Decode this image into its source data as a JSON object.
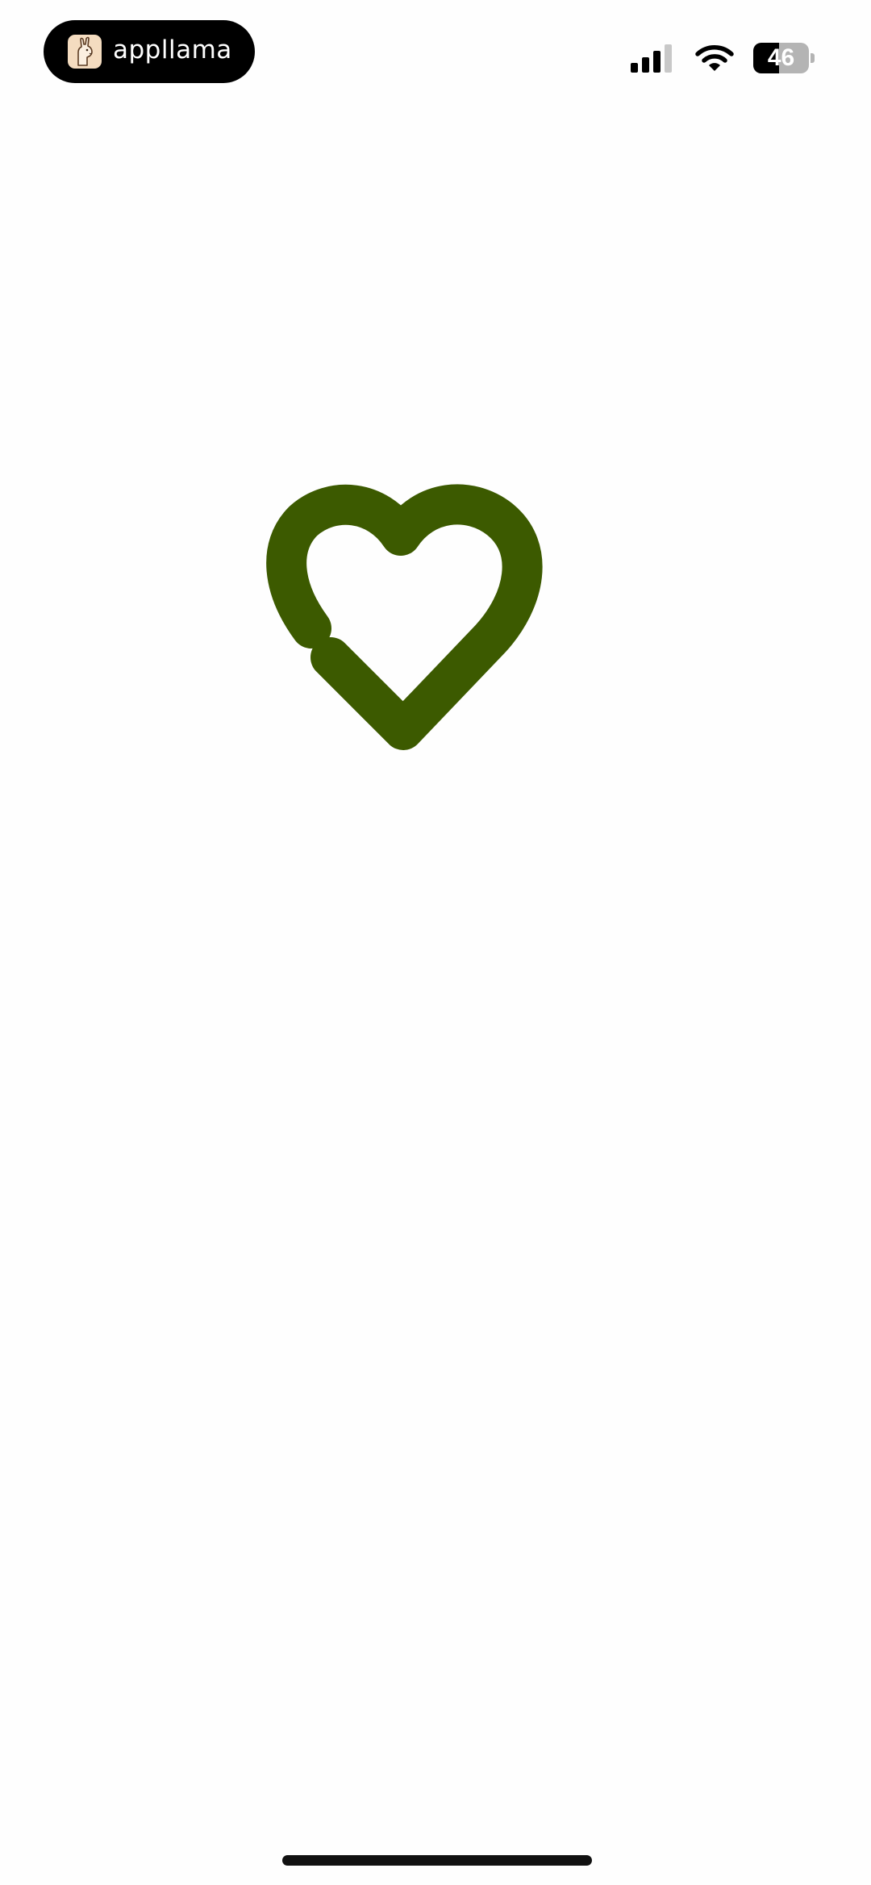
{
  "status_bar": {
    "app_pill": {
      "app_name": "appllama",
      "icon": "llama-icon"
    },
    "signal_icon": "cellular-signal-icon",
    "wifi_icon": "wifi-icon",
    "battery": {
      "percent_label": "46",
      "level": 0.46
    }
  },
  "splash": {
    "logo_icon": "heart-checkmark-logo-icon",
    "logo_color": "#3c5a00"
  }
}
